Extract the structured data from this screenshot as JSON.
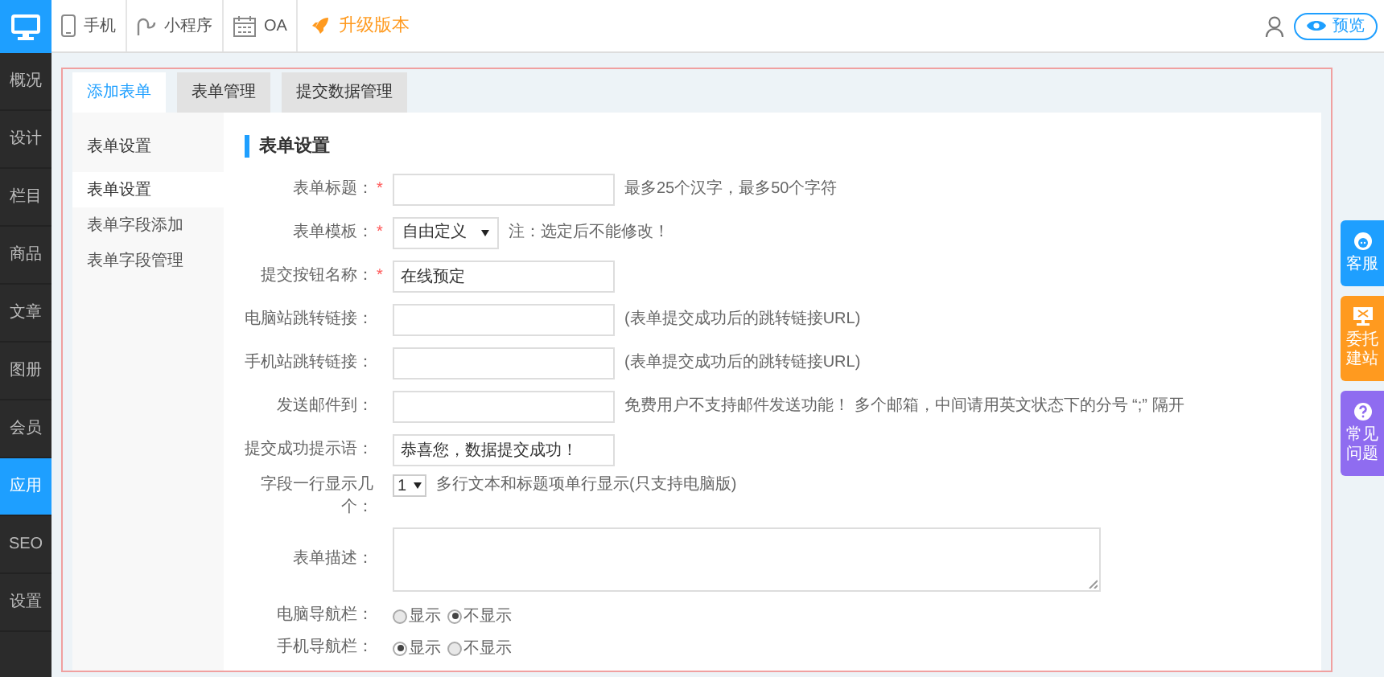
{
  "top_bar": {
    "items": [
      {
        "label": "手机",
        "kind": "phone"
      },
      {
        "label": "小程序",
        "kind": "miniapp"
      },
      {
        "label": "OA",
        "kind": "calendar"
      }
    ],
    "upgrade": "升级版本",
    "preview_button": "预览"
  },
  "sidebar": {
    "items": [
      {
        "label": "概况",
        "selected": false
      },
      {
        "label": "设计",
        "selected": false
      },
      {
        "label": "栏目",
        "selected": false
      },
      {
        "label": "商品",
        "selected": false
      },
      {
        "label": "文章",
        "selected": false
      },
      {
        "label": "图册",
        "selected": false
      },
      {
        "label": "会员",
        "selected": false
      },
      {
        "label": "应用",
        "selected": true
      },
      {
        "label": "SEO",
        "selected": false
      },
      {
        "label": "设置",
        "selected": false
      }
    ]
  },
  "tabs": [
    {
      "label": "添加表单",
      "selected": true
    },
    {
      "label": "表单管理",
      "selected": false
    },
    {
      "label": "提交数据管理",
      "selected": false
    }
  ],
  "subnav": {
    "title": "表单设置",
    "items": [
      {
        "label": "表单设置",
        "selected": true
      },
      {
        "label": "表单字段添加",
        "selected": false
      },
      {
        "label": "表单字段管理",
        "selected": false
      }
    ]
  },
  "section_title": "表单设置",
  "form": {
    "rows": [
      {
        "kind": "input",
        "label": "表单标题：",
        "required_mark": "*",
        "hint": "最多25个汉字，最多50个字符"
      },
      {
        "kind": "select",
        "label": "表单模板：",
        "required_mark": "*",
        "value": "自由定义",
        "hint": "注：选定后不能修改！"
      },
      {
        "kind": "input",
        "label": "提交按钮名称：",
        "required_mark": "*",
        "value": "在线预定"
      },
      {
        "kind": "input",
        "label": "电脑站跳转链接：",
        "hint": "(表单提交成功后的跳转链接URL)"
      },
      {
        "kind": "input",
        "label": "手机站跳转链接：",
        "hint": "(表单提交成功后的跳转链接URL)"
      },
      {
        "kind": "input",
        "label": "发送邮件到：",
        "hint": "免费用户不支持邮件发送功能！ 多个邮箱，中间请用英文状态下的分号 “;” 隔开"
      },
      {
        "kind": "input",
        "label": "提交成功提示语：",
        "value": "恭喜您，数据提交成功！"
      },
      {
        "kind": "count",
        "label": "字段一行显示几个：",
        "value": "1",
        "hint": "多行文本和标题项单行显示(只支持电脑版)"
      },
      {
        "kind": "textarea",
        "label": "表单描述："
      },
      {
        "kind": "radio",
        "label": "电脑导航栏：",
        "options": [
          {
            "label": "显示",
            "selected": false
          },
          {
            "label": "不显示",
            "selected": true
          }
        ]
      },
      {
        "kind": "radio",
        "label": "手机导航栏：",
        "options": [
          {
            "label": "显示",
            "selected": true
          },
          {
            "label": "不显示",
            "selected": false
          }
        ]
      }
    ]
  },
  "float_buttons": [
    {
      "label": "客服",
      "kind": "service",
      "color": "#1e9fff"
    },
    {
      "label": "委托建站",
      "kind": "build",
      "color": "#ff9a1f"
    },
    {
      "label": "常见问题",
      "kind": "faq",
      "color": "#8f6cf0"
    }
  ]
}
